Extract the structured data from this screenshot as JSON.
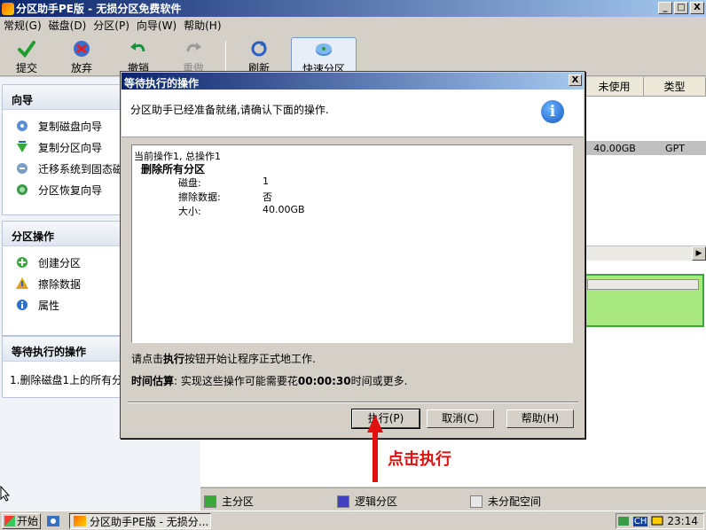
{
  "window": {
    "title": "分区助手PE版 - 无损分区免费软件",
    "min_label": "_",
    "max_label": "□",
    "close_label": "X"
  },
  "menu": [
    "常规(G)",
    "磁盘(D)",
    "分区(P)",
    "向导(W)",
    "帮助(H)"
  ],
  "toolbar": {
    "submit": "提交",
    "discard": "放弃",
    "undo": "撤销",
    "redo": "重做",
    "refresh": "刷新",
    "quick_partition": "快速分区"
  },
  "left": {
    "wizard": {
      "title": "向导",
      "items": [
        "复制磁盘向导",
        "复制分区向导",
        "迁移系统到固态磁",
        "分区恢复向导"
      ]
    },
    "partition_ops": {
      "title": "分区操作",
      "items": [
        "创建分区",
        "擦除数据",
        "属性"
      ]
    },
    "pending": {
      "title": "等待执行的操作",
      "items": [
        "1.删除磁盘1上的所有分"
      ]
    }
  },
  "grid": {
    "columns": [
      "未使用",
      "类型"
    ],
    "row": [
      "40.00GB",
      "GPT"
    ]
  },
  "legend": [
    "主分区",
    "逻辑分区",
    "未分配空间"
  ],
  "colors": {
    "primary": "#3aa83a",
    "logical": "#4040c0",
    "unallocated": "#e8e8e8",
    "titlebar": "#0a246a"
  },
  "dialog": {
    "title": "等待执行的操作",
    "close_label": "X",
    "message": "分区助手已经准备就绪,请确认下面的操作.",
    "summary": "当前操作1, 总操作1",
    "op_title": "删除所有分区",
    "details": [
      {
        "k": "磁盘:",
        "v": "1"
      },
      {
        "k": "擦除数据:",
        "v": "否"
      },
      {
        "k": "大小:",
        "v": "40.00GB"
      }
    ],
    "hint_pre": "请点击",
    "hint_bold": "执行",
    "hint_post": "按钮开始让程序正式地工作.",
    "est_label": "时间估算",
    "est_pre": ": 实现这些操作可能需要花",
    "est_time": "00:00:30",
    "est_post": "时间或更多.",
    "buttons": {
      "execute": "执行(P)",
      "cancel": "取消(C)",
      "help": "帮助(H)"
    }
  },
  "annotation": "点击执行",
  "taskbar": {
    "start": "开始",
    "task": "分区助手PE版 - 无损分...",
    "lang": "CH",
    "clock": "23:14"
  }
}
